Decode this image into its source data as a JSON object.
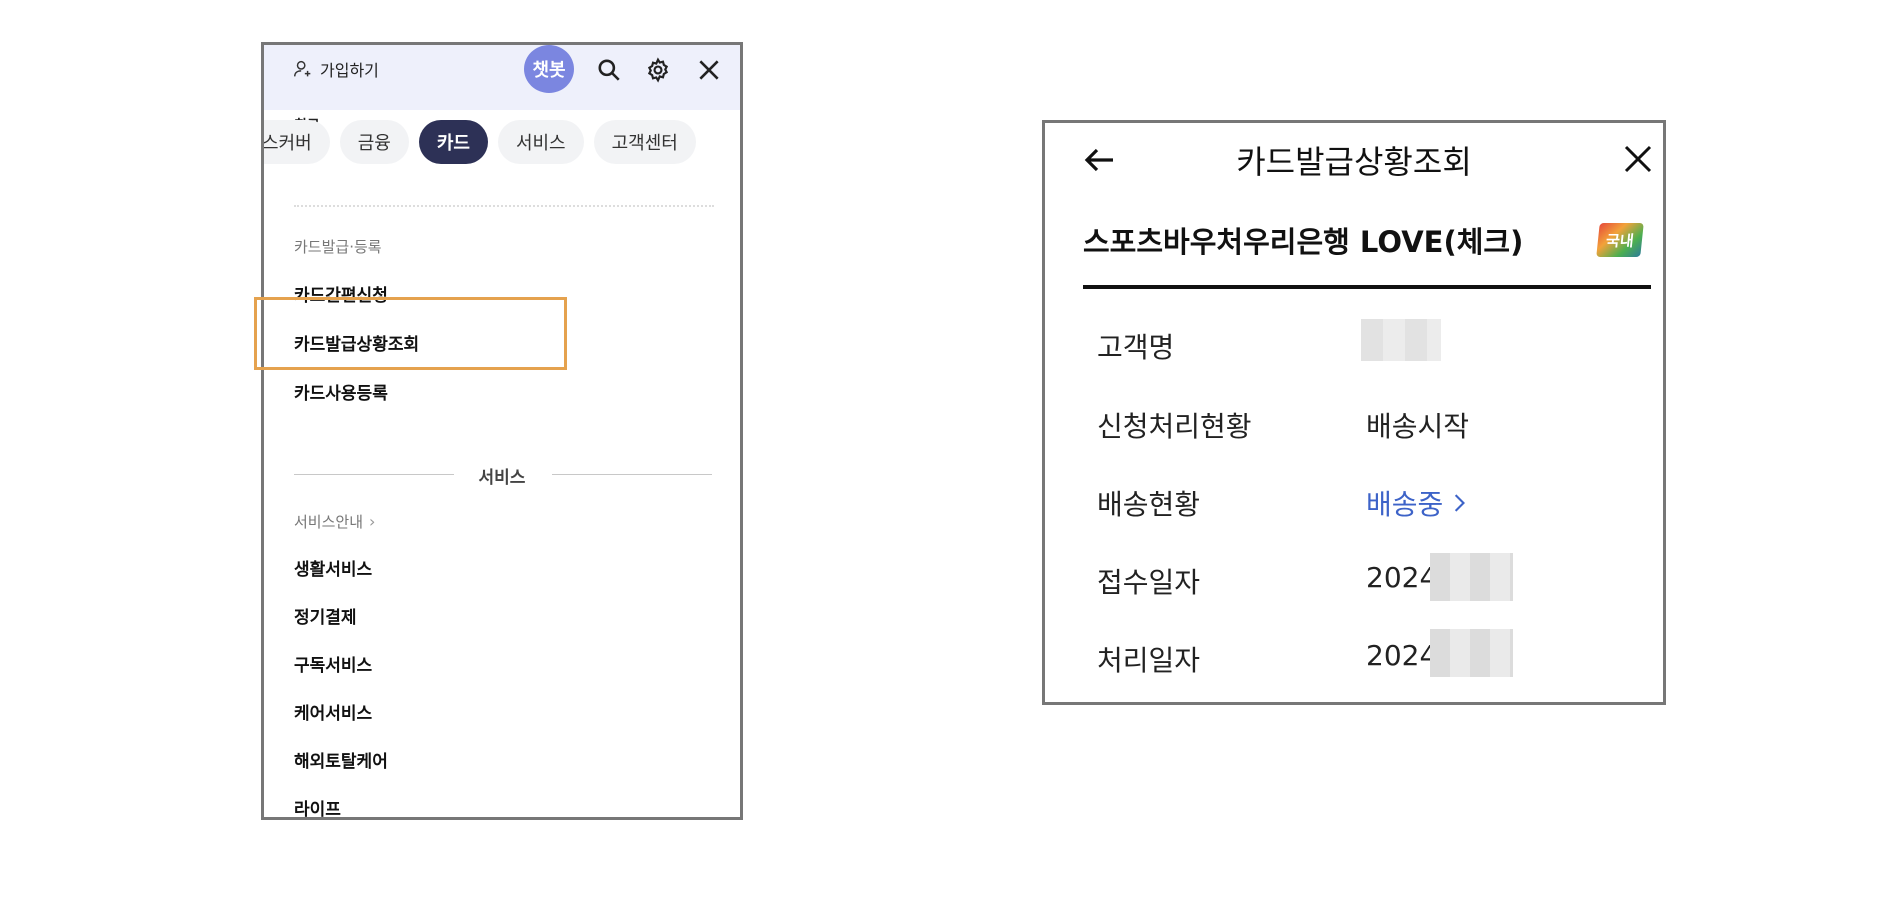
{
  "left": {
    "header": {
      "signup_label": "가입하기",
      "chatbot_label": "챗봇",
      "icons": [
        "user-add-icon",
        "search-icon",
        "gear-icon",
        "close-icon"
      ]
    },
    "recent_label": "최근",
    "tabs": [
      {
        "label": "스커버",
        "active": false
      },
      {
        "label": "금융",
        "active": false
      },
      {
        "label": "카드",
        "active": true
      },
      {
        "label": "서비스",
        "active": false
      },
      {
        "label": "고객센터",
        "active": false
      }
    ],
    "card_section": {
      "title": "카드발급·등록",
      "items": [
        "카드간편신청",
        "카드발급상황조회",
        "카드사용등록"
      ]
    },
    "service_divider": "서비스",
    "service_section": {
      "title": "서비스안내",
      "items": [
        "생활서비스",
        "정기결제",
        "구독서비스",
        "케어서비스",
        "해외토탈케어",
        "라이프"
      ]
    },
    "highlight_color": "#e5a24e"
  },
  "right": {
    "title": "카드발급상황조회",
    "card_name": "스포츠바우처우리은행 LOVE(체크)",
    "badge_label": "국내",
    "rows": [
      {
        "label": "고객명",
        "value": ""
      },
      {
        "label": "신청처리현황",
        "value": "배송시작"
      },
      {
        "label": "배송현황",
        "value": "배송중"
      },
      {
        "label": "접수일자",
        "value": "2024."
      },
      {
        "label": "처리일자",
        "value": "2024."
      }
    ],
    "link_color": "#3d63c8"
  }
}
